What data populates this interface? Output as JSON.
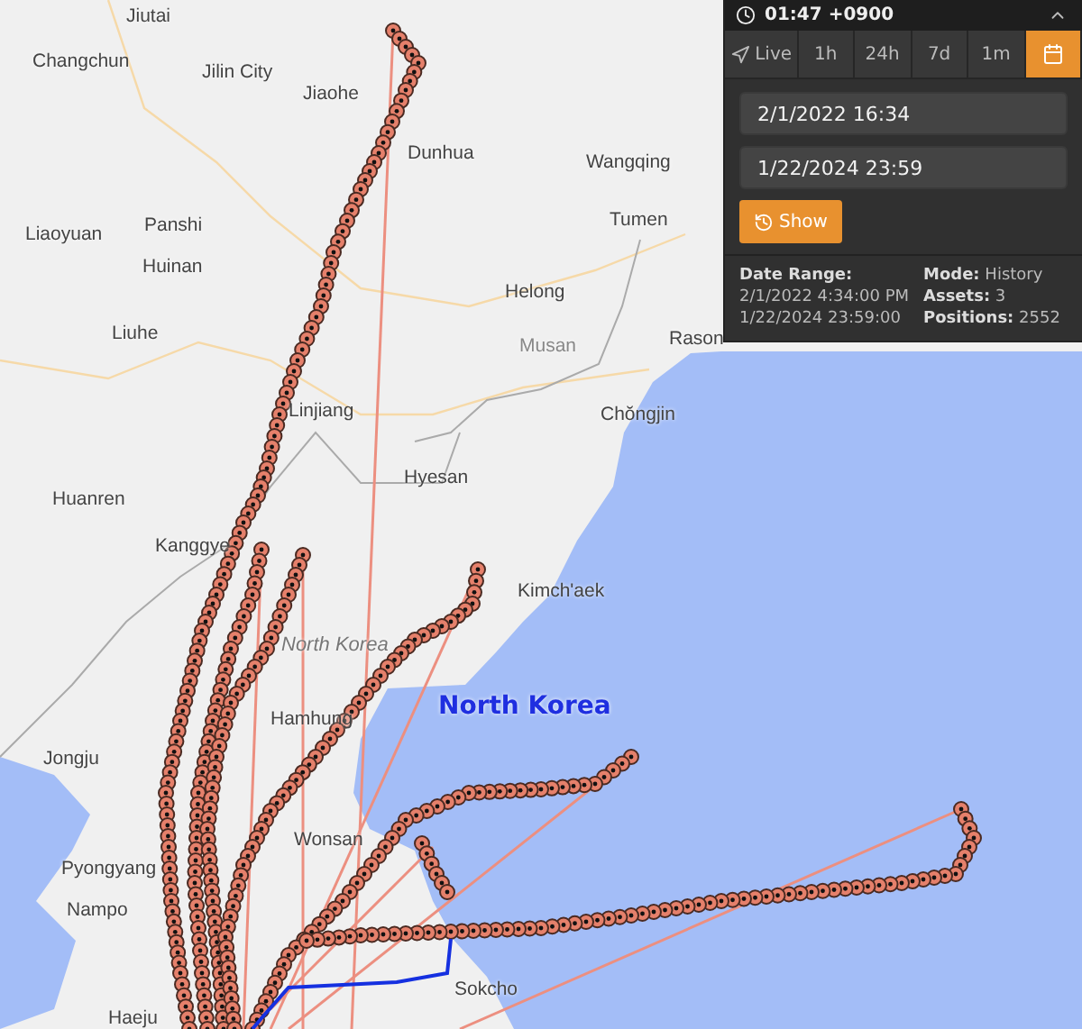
{
  "map": {
    "labels": [
      {
        "text": "Jiutai",
        "kind": "city"
      },
      {
        "text": "Changchun",
        "kind": "city"
      },
      {
        "text": "Jilin City",
        "kind": "city"
      },
      {
        "text": "Jiaohe",
        "kind": "city"
      },
      {
        "text": "Dunhua",
        "kind": "city"
      },
      {
        "text": "Wangqing",
        "kind": "city"
      },
      {
        "text": "Tumen",
        "kind": "city"
      },
      {
        "text": "Panshi",
        "kind": "city"
      },
      {
        "text": "Liaoyuan",
        "kind": "city"
      },
      {
        "text": "Huinan",
        "kind": "city"
      },
      {
        "text": "Helong",
        "kind": "city"
      },
      {
        "text": "Liuhe",
        "kind": "city"
      },
      {
        "text": "Musan",
        "kind": "minor"
      },
      {
        "text": "Rason",
        "kind": "city"
      },
      {
        "text": "Chŏngjin",
        "kind": "city"
      },
      {
        "text": "Linjiang",
        "kind": "city"
      },
      {
        "text": "Hyesan",
        "kind": "city"
      },
      {
        "text": "Huanren",
        "kind": "city"
      },
      {
        "text": "Kanggye",
        "kind": "city"
      },
      {
        "text": "Kimch'aek",
        "kind": "city"
      },
      {
        "text": "North Korea",
        "kind": "region"
      },
      {
        "text": "Hamhung",
        "kind": "city"
      },
      {
        "text": "Jongju",
        "kind": "city"
      },
      {
        "text": "North Korea",
        "kind": "country"
      },
      {
        "text": "Wonsan",
        "kind": "city"
      },
      {
        "text": "Pyongyang",
        "kind": "city"
      },
      {
        "text": "Nampo",
        "kind": "city"
      },
      {
        "text": "Sokcho",
        "kind": "city"
      },
      {
        "text": "Haeju",
        "kind": "city"
      }
    ]
  },
  "panel": {
    "clock": "01:47 +0900",
    "expanded": true,
    "tabs": [
      {
        "kind": "live",
        "label": "Live",
        "selected": false
      },
      {
        "kind": "text",
        "label": "1h",
        "selected": false
      },
      {
        "kind": "text",
        "label": "24h",
        "selected": false
      },
      {
        "kind": "text",
        "label": "7d",
        "selected": false
      },
      {
        "kind": "text",
        "label": "1m",
        "selected": false
      },
      {
        "kind": "calendar",
        "selected": true
      }
    ],
    "start": "2/1/2022 16:34",
    "end": "1/22/2024 23:59",
    "button": "Show",
    "info": {
      "range_label": "Date Range:",
      "range_start": "2/1/2022 4:34:00 PM",
      "range_end": "1/22/2024 23:59:00",
      "stats": [
        {
          "label": "Mode:",
          "value": "History"
        },
        {
          "label": "Assets:",
          "value": "3"
        },
        {
          "label": "Positions:",
          "value": "2552"
        }
      ]
    }
  }
}
